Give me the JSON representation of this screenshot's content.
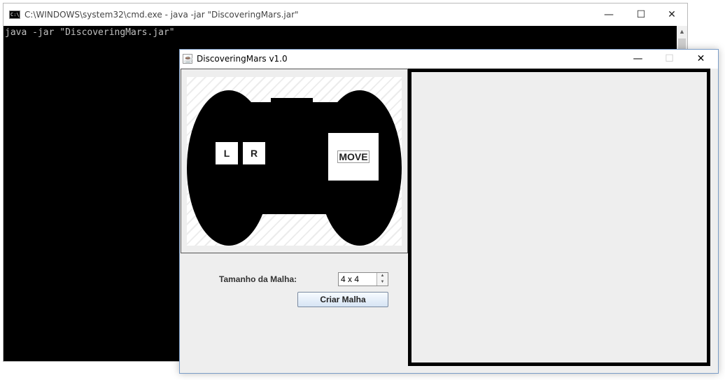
{
  "cmd_window": {
    "icon_text": "C:\\",
    "title": "C:\\WINDOWS\\system32\\cmd.exe - java  -jar \"DiscoveringMars.jar\"",
    "console_text": "java -jar \"DiscoveringMars.jar\"",
    "minimize_glyph": "—",
    "maximize_glyph": "☐",
    "close_glyph": "✕",
    "scroll_up_glyph": "▲"
  },
  "java_window": {
    "icon_glyph": "☕",
    "title": "DiscoveringMars v1.0",
    "minimize_glyph": "—",
    "maximize_glyph": "☐",
    "close_glyph": "✕",
    "controller": {
      "left_button": "L",
      "right_button": "R",
      "move_button": "MOVE",
      "body_color": "#000000"
    },
    "grid_form": {
      "label": "Tamanho da Malha:",
      "value": "4 x 4",
      "spin_up_glyph": "▲",
      "spin_down_glyph": "▼",
      "create_button": "Criar Malha"
    }
  }
}
